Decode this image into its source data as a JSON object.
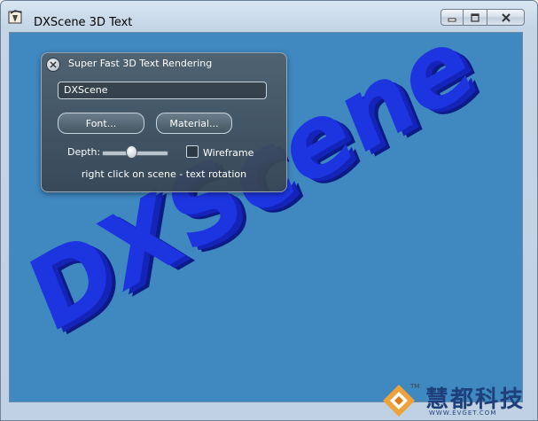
{
  "window": {
    "title": "DXScene 3D Text"
  },
  "panel": {
    "title": "Super Fast 3D Text Rendering",
    "text_value": "DXScene",
    "font_button": "Font...",
    "material_button": "Material...",
    "depth_label": "Depth:",
    "depth_value": 0.45,
    "wireframe_label": "Wireframe",
    "wireframe_checked": false,
    "hint": "right click on scene - text rotation"
  },
  "scene": {
    "text": "DXScene",
    "text_color": "#1c35e0",
    "text_side_color": "#0c1a86",
    "background": "#3f88c0"
  },
  "watermark": {
    "tm": "TM",
    "text": "慧都科技",
    "url": "WWW.EVGET.COM"
  },
  "icons": {
    "app": "dxscene-app-icon",
    "panel_close": "close-icon",
    "minimize": "minimize-icon",
    "maximize": "maximize-icon",
    "close": "close-icon"
  }
}
